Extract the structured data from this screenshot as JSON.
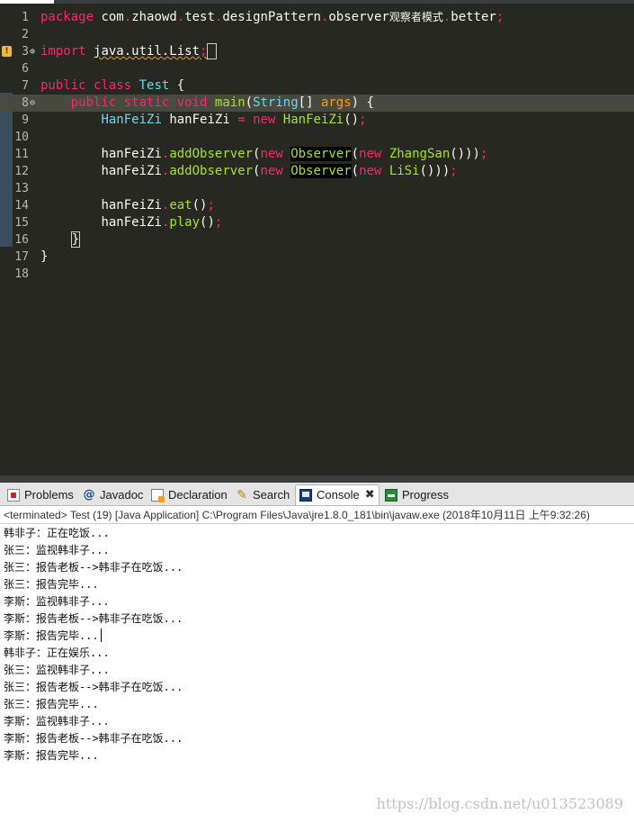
{
  "editor": {
    "package_kw": "package",
    "package_name_parts": [
      "com",
      "zhaowd",
      "test",
      "designPattern",
      "observer",
      "观察者模式",
      "better"
    ],
    "import_kw": "import",
    "import_path": "java.util.List",
    "line_numbers": [
      "1",
      "2",
      "3",
      "6",
      "7",
      "8",
      "9",
      "10",
      "11",
      "12",
      "13",
      "14",
      "15",
      "16",
      "17",
      "18"
    ],
    "fold_marker": "⊕",
    "current_marker": "⊖",
    "warning_symbol": "!",
    "kw_public": "public",
    "kw_class": "class",
    "class_name": "Test",
    "kw_static": "static",
    "kw_void": "void",
    "method_main": "main",
    "type_string": "String",
    "param_args": "args",
    "type_hanfeizi": "HanFeiZi",
    "var_hanfeizi": "hanFeiZi",
    "kw_new": "new",
    "method_add_observer": "addObserver",
    "type_observer": "Observer",
    "type_zhangsan": "ZhangSan",
    "type_lisi": "LiSi",
    "method_eat": "eat",
    "method_play": "play"
  },
  "views": {
    "tabs": [
      {
        "label": "Problems",
        "icon": "problems-icon"
      },
      {
        "label": "Javadoc",
        "icon": "javadoc-icon"
      },
      {
        "label": "Declaration",
        "icon": "declaration-icon"
      },
      {
        "label": "Search",
        "icon": "search-icon"
      },
      {
        "label": "Console",
        "icon": "console-icon",
        "active": true
      },
      {
        "label": "Progress",
        "icon": "progress-icon"
      }
    ],
    "close_glyph": "✖"
  },
  "console": {
    "status": "<terminated> Test (19) [Java Application] C:\\Program Files\\Java\\jre1.8.0_181\\bin\\javaw.exe (2018年10月11日 上午9:32:26)",
    "lines": [
      "韩非子：正在吃饭...",
      "张三：监视韩非子...",
      "张三：报告老板-->韩非子在吃饭...",
      "张三：报告完毕...",
      "李斯：监视韩非子...",
      "李斯：报告老板-->韩非子在吃饭...",
      "李斯：报告完毕...",
      "韩非子：正在娱乐...",
      "张三：监视韩非子...",
      "张三：报告老板-->韩非子在吃饭...",
      "张三：报告完毕...",
      "李斯：监视韩非子...",
      "李斯：报告老板-->韩非子在吃饭...",
      "李斯：报告完毕..."
    ]
  },
  "watermark": "https://blog.csdn.net/u013523089",
  "colors": {
    "editor_bg": "#272822",
    "keyword": "#f92672",
    "type": "#66d9ef",
    "function": "#a6e22e",
    "parameter": "#fd971f"
  }
}
